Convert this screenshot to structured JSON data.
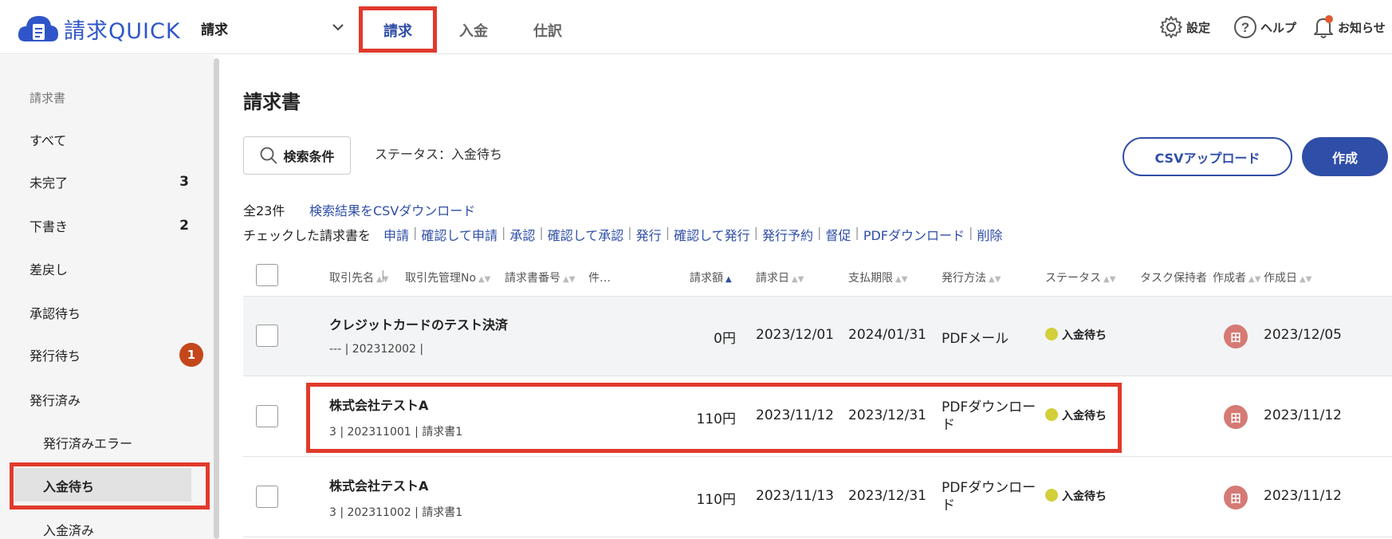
{
  "header": {
    "logo_text": "請求QUICK",
    "sub_select_label": "請求",
    "tabs": [
      {
        "label": "請求",
        "active": true
      },
      {
        "label": "入金",
        "active": false
      },
      {
        "label": "仕訳",
        "active": false
      }
    ],
    "tools": {
      "settings_label": "設定",
      "help_label": "ヘルプ",
      "notifications_label": "お知らせ"
    },
    "accent_color": "#2f4ea7",
    "highlight_color": "#e13a2c"
  },
  "sidebar": {
    "heading": "請求書",
    "items": [
      {
        "label": "すべて",
        "count": ""
      },
      {
        "label": "未完了",
        "count": "3"
      },
      {
        "label": "下書き",
        "count": "2"
      },
      {
        "label": "差戻し",
        "count": ""
      },
      {
        "label": "承認待ち",
        "count": ""
      },
      {
        "label": "発行待ち",
        "badge": "1"
      },
      {
        "label": "発行済み",
        "count": ""
      },
      {
        "label": "発行済みエラー",
        "count": ""
      },
      {
        "label": "入金待ち",
        "active": true
      },
      {
        "label": "入金済み",
        "count": ""
      }
    ]
  },
  "main": {
    "title": "請求書",
    "search_button": "検索条件",
    "status_filter": "ステータス：入金待ち",
    "csv_upload_button": "CSVアップロード",
    "create_button": "作成",
    "total": "全23件",
    "csv_download_link": "検索結果をCSVダウンロード",
    "bulk_lead": "チェックした請求書を",
    "bulk_actions": [
      "申請",
      "確認して申請",
      "承認",
      "確認して承認",
      "発行",
      "確認して発行",
      "発行予約",
      "督促",
      "PDFダウンロード",
      "削除"
    ]
  },
  "table": {
    "headers": {
      "client": "取引先名",
      "client_no": "取引先管理No",
      "invoice_no": "請求書番号",
      "subject": "件…",
      "amount": "請求額",
      "invoice_date": "請求日",
      "due_date": "支払期限",
      "method": "発行方法",
      "status": "ステータス",
      "task_owner": "タスク保持者",
      "creator": "作成者",
      "created": "作成日"
    },
    "rows": [
      {
        "client": "クレジットカードのテスト決済",
        "meta": "--- | 202312002 |",
        "amount": "0円",
        "invoice_date": "2023/12/01",
        "due_date": "2024/01/31",
        "method_line1": "PDFメール",
        "method_line2": "",
        "status": "入金待ち",
        "creator": "田",
        "created": "2023/12/05"
      },
      {
        "client": "株式会社テストA",
        "meta": "3 | 202311001 | 請求書1",
        "amount": "110円",
        "invoice_date": "2023/11/12",
        "due_date": "2023/12/31",
        "method_line1": "PDFダウンロー",
        "method_line2": "ド",
        "status": "入金待ち",
        "creator": "田",
        "created": "2023/11/12"
      },
      {
        "client": "株式会社テストA",
        "meta": "3 | 202311002 | 請求書1",
        "amount": "110円",
        "invoice_date": "2023/11/13",
        "due_date": "2023/12/31",
        "method_line1": "PDFダウンロー",
        "method_line2": "ド",
        "status": "入金待ち",
        "creator": "田",
        "created": "2023/11/12"
      }
    ]
  }
}
